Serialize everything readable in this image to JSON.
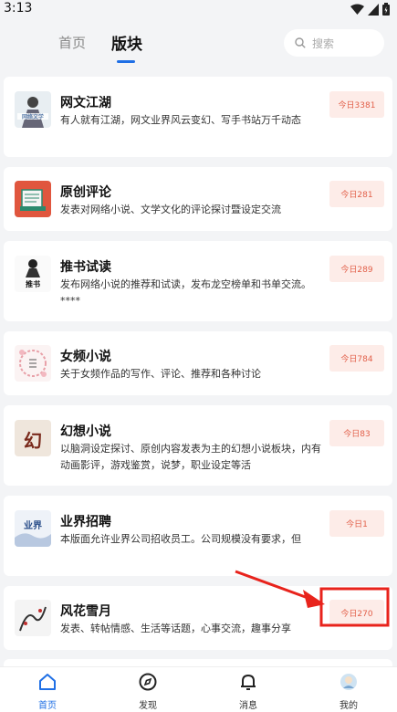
{
  "status_bar": {
    "time": "3:13"
  },
  "header": {
    "tabs": [
      {
        "label": "首页"
      },
      {
        "label": "版块"
      }
    ],
    "search_placeholder": "搜索"
  },
  "forums": [
    {
      "title": "网文江湖",
      "desc": "有人就有江湖，网文业界风云变幻、写手书站万千动态",
      "today": "今日3381"
    },
    {
      "title": "原创评论",
      "desc": "发表对网络小说、文学文化的评论探讨暨设定交流",
      "today": "今日281"
    },
    {
      "title": "推书试读",
      "desc": "发布网络小说的推荐和试读，发布龙空榜单和书单交流。****",
      "today": "今日289"
    },
    {
      "title": "女频小说",
      "desc": "关于女频作品的写作、评论、推荐和各种讨论",
      "today": "今日784"
    },
    {
      "title": "幻想小说",
      "desc": "以脑洞设定探讨、原创内容发表为主的幻想小说板块，内有动画影评，游戏鉴赏，说梦，职业设定等活",
      "today": "今日83"
    },
    {
      "title": "业界招聘",
      "desc": "本版面允许业界公司招收员工。公司规模没有要求，但",
      "today": "今日1"
    },
    {
      "title": "风花雪月",
      "desc": "发表、转帖情感、生活等话题，心事交流，趣事分享",
      "today": "今日270"
    }
  ],
  "bottom_nav": [
    {
      "label": "首页",
      "icon": "home-icon"
    },
    {
      "label": "发现",
      "icon": "compass-icon"
    },
    {
      "label": "消息",
      "icon": "bell-icon"
    },
    {
      "label": "我的",
      "icon": "avatar-icon"
    }
  ],
  "colors": {
    "accent": "#1f6fe5",
    "badge_text": "#e2604a",
    "badge_bg": "#fdece8",
    "annotation": "#e8231c"
  }
}
